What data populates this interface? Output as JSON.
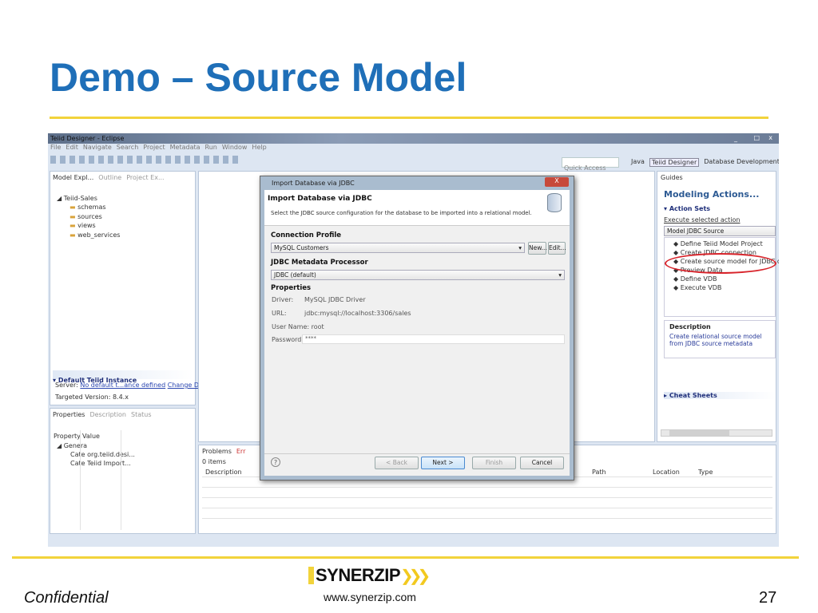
{
  "slide": {
    "title": "Demo – Source Model",
    "footer_left": "Confidential",
    "footer_url": "www.synerzip.com",
    "page_number": "27",
    "logo": "SYNERZIP"
  },
  "colors": {
    "title": "#1f6fb8",
    "rule": "#f2d33b",
    "highlight": "#d8232a"
  },
  "eclipse": {
    "window_title": "Teiid Designer - Eclipse",
    "menu": [
      "File",
      "Edit",
      "Navigate",
      "Search",
      "Project",
      "Metadata",
      "Run",
      "Window",
      "Help"
    ],
    "quick_access": "Quick Access",
    "perspectives": [
      "Java",
      "Teiid Designer",
      "Database Development"
    ],
    "explorer": {
      "tabs": [
        "Model Expl...",
        "Outline",
        "Project Ex..."
      ],
      "project": "Teiid-Sales",
      "folders": [
        "schemas",
        "sources",
        "views",
        "web_services"
      ]
    },
    "teiid_instance": {
      "header": "Default Teiid Instance",
      "server_label": "Server:",
      "server_link": "No default t...ance defined",
      "change_link": "Change Default...",
      "version": "Targeted Version: 8.4.x"
    },
    "properties": {
      "tabs": [
        "Properties",
        "Description",
        "Status"
      ],
      "columns": [
        "Property",
        "Value"
      ],
      "rows": [
        [
          "Genera",
          ""
        ],
        [
          "Cate",
          "org.teiid.desi..."
        ],
        [
          "Cate",
          "Teiid Import..."
        ]
      ]
    },
    "guides": {
      "tab": "Guides",
      "heading": "Modeling Actions...",
      "action_sets": "Action Sets",
      "execute_link": "Execute selected action",
      "selected_set": "Model JDBC Source",
      "actions": [
        "Define Teiid Model Project",
        "Create JDBC connection",
        "Create source model for JDBC d",
        "Preview Data",
        "Define VDB",
        "Execute VDB"
      ],
      "desc_header": "Description",
      "desc_text": "Create relational source model from JDBC source metadata",
      "cheat_sheets": "Cheat Sheets"
    },
    "problems": {
      "tabs": [
        "Problems",
        "Err"
      ],
      "count": "0 items",
      "columns": [
        "Description",
        "Path",
        "Location",
        "Type"
      ]
    },
    "dialog": {
      "title": "Import Database via JDBC",
      "heading": "Import Database via JDBC",
      "subtitle": "Select the JDBC source configuration for the database to be imported into a relational model.",
      "conn_label": "Connection Profile",
      "conn_value": "MySQL Customers",
      "new_btn": "New...",
      "edit_btn": "Edit...",
      "proc_label": "JDBC Metadata Processor",
      "proc_value": "JDBC (default)",
      "props_label": "Properties",
      "driver_label": "Driver:",
      "driver": "MySQL JDBC Driver",
      "url_label": "URL:",
      "url": "jdbc:mysql://localhost:3306/sales",
      "user_label": "User Name:",
      "user": "root",
      "pw_label": "Password:",
      "pw": "****",
      "back": "< Back",
      "next": "Next >",
      "finish": "Finish",
      "cancel": "Cancel",
      "help": "?"
    }
  }
}
